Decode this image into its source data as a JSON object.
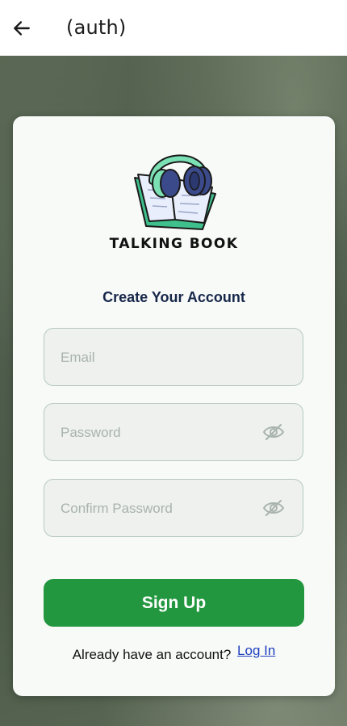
{
  "appbar": {
    "title": "(auth)",
    "back_icon": "arrow-left-icon"
  },
  "logo": {
    "text": "TALKING BOOK",
    "icon": "book-with-headphones-logo",
    "colors": {
      "mint": "#7be0b4",
      "teal": "#3fbf8c",
      "navy": "#3b4a8a",
      "page": "#e8eefc"
    }
  },
  "form": {
    "heading": "Create Your Account",
    "email_placeholder": "Email",
    "password_placeholder": "Password",
    "confirm_placeholder": "Confirm Password",
    "eye_icon": "eye-off-icon",
    "signup_label": "Sign Up",
    "footer_text": "Already have an account?",
    "login_label": "Log In"
  },
  "colors": {
    "primary_button": "#23973f",
    "heading": "#17274a",
    "link": "#1f3fbf",
    "field_border": "#b7c9bf"
  }
}
